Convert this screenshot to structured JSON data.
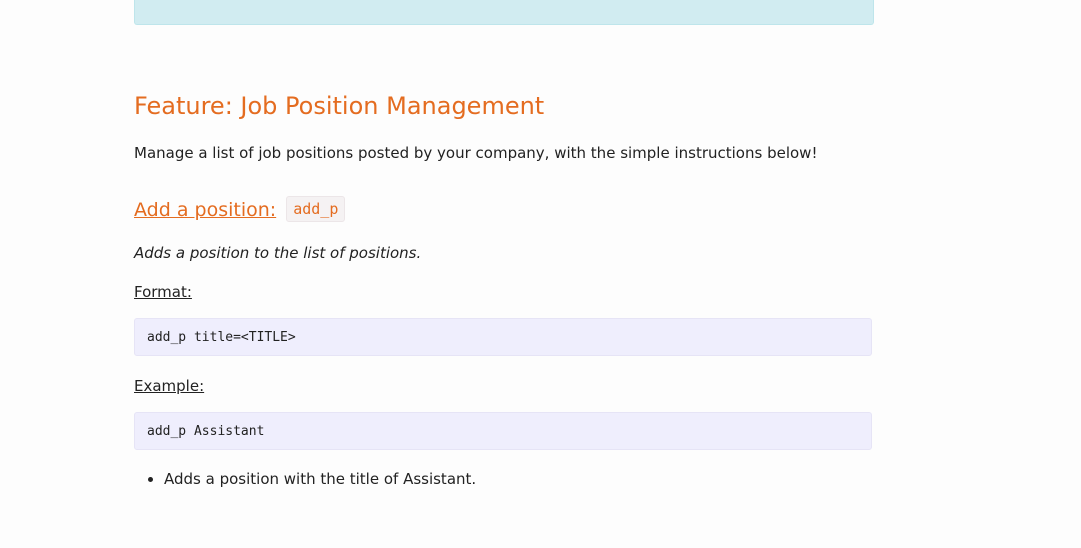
{
  "feature": {
    "title": "Feature: Job Position Management",
    "description": "Manage a list of job positions posted by your company, with the simple instructions below!"
  },
  "command": {
    "heading_link": "Add a position:",
    "keyword": "add_p",
    "description": "Adds a position to the list of positions.",
    "format_label": "Format:",
    "format_code": "add_p title=<TITLE>",
    "example_label": "Example:",
    "example_code": "add_p Assistant",
    "notes": [
      "Adds a position with the title of Assistant."
    ]
  },
  "colors": {
    "accent": "#e46c20",
    "info_box": "#d1ecf1",
    "code_block": "#efeefd"
  }
}
